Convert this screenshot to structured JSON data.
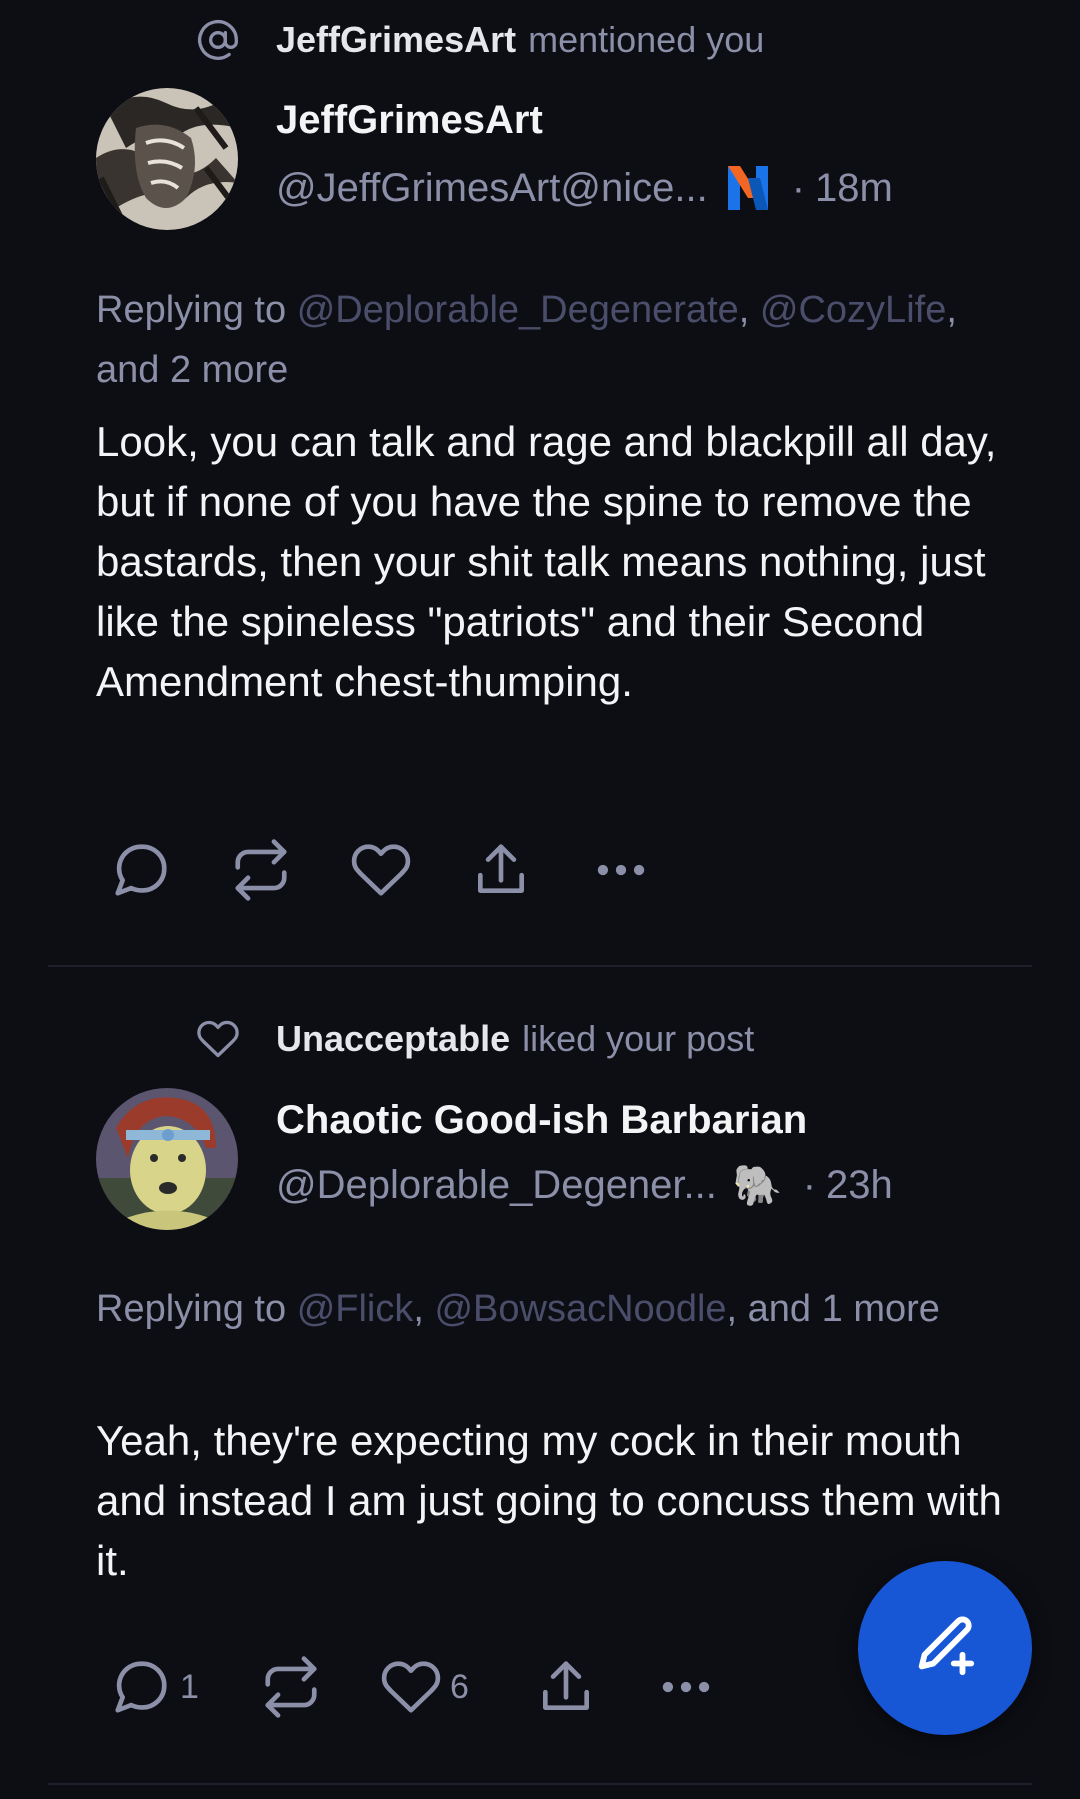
{
  "colors": {
    "background": "#0d0e14",
    "text_primary": "#f3f4f6",
    "text_muted": "#8b8fa8",
    "mention": "#4b4e6b",
    "fab": "#1757d6"
  },
  "notifications": [
    {
      "reason_icon": "at-icon",
      "reason_user": "JeffGrimesArt",
      "reason_text": "mentioned you",
      "display_name": "JeffGrimesArt",
      "handle": "@JeffGrimesArt@nice...",
      "instance_icon": "n-logo-icon",
      "separator": "·",
      "time": "18m",
      "reply_prefix": "Replying to",
      "reply_mention_1": "@Deplorable_Degenerate",
      "reply_sep_1": ",",
      "reply_mention_2": "@CozyLife",
      "reply_suffix": ", and 2 more",
      "text": "Look, you can talk and rage and blackpill all day, but if none of you have the spine to remove the bastards, then your shit talk means nothing, just like the spineless \"patriots\" and their Second Amendment chest-thumping.",
      "actions": {
        "reply_icon": "reply-icon",
        "repost_icon": "repost-icon",
        "like_icon": "heart-icon",
        "share_icon": "share-icon",
        "more_icon": "more-icon"
      }
    },
    {
      "reason_icon": "heart-icon",
      "reason_user": "Unacceptable",
      "reason_text": "liked your post",
      "display_name": "Chaotic Good-ish Barbarian",
      "handle": "@Deplorable_Degener...",
      "instance_icon": "elephant-emoji",
      "instance_glyph": "🐘",
      "separator": "·",
      "time": "23h",
      "reply_prefix": "Replying to",
      "reply_mention_1": "@Flick",
      "reply_sep_1": ",",
      "reply_mention_2": "@BowsacNoodle",
      "reply_suffix": ", and 1 more",
      "text": "Yeah, they're expecting my cock in their mouth and instead I am just going to concuss them with it.",
      "actions": {
        "reply_count": "1",
        "like_count": "6",
        "reply_icon": "reply-icon",
        "repost_icon": "repost-icon",
        "like_icon": "heart-icon",
        "share_icon": "share-icon",
        "more_icon": "more-icon"
      }
    }
  ],
  "fab": {
    "icon": "compose-icon"
  }
}
